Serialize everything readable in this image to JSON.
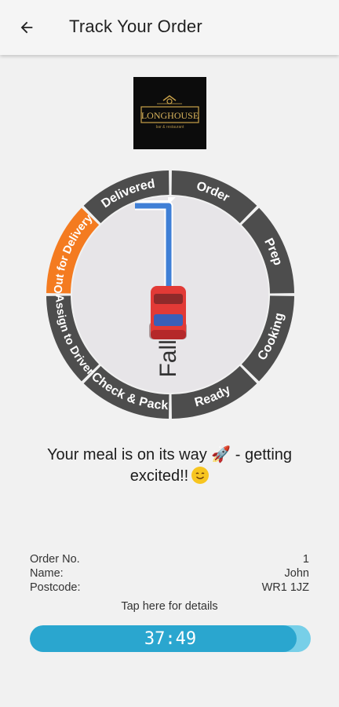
{
  "appbar": {
    "title": "Track Your Order"
  },
  "logo": {
    "text": "LONGHOUSE",
    "tagline": "bar & restaurant"
  },
  "tracker": {
    "segments": [
      "Order",
      "Prep",
      "Cooking",
      "Ready",
      "Check & Pack",
      "Assign to Driver",
      "Out for Delivery",
      "Delivered"
    ],
    "active_segment": "Out for Delivery",
    "street_label": "Fall St",
    "colors": {
      "segment": "#4d4d4d",
      "active": "#f47b20",
      "map": "#e7e5e8",
      "route": "#3f7fd6",
      "car": "#e23a36"
    }
  },
  "message": {
    "text": "Your meal is on its way 🚀 - getting excited!!"
  },
  "order": {
    "rows": [
      {
        "label": "Order No.",
        "value": "1"
      },
      {
        "label": "Name:",
        "value": "John"
      },
      {
        "label": "Postcode:",
        "value": "WR1 1JZ"
      }
    ],
    "details_link": "Tap here for details"
  },
  "timer": {
    "minutes": "37",
    "separator": ":",
    "seconds": "49",
    "progress": 0.95
  }
}
